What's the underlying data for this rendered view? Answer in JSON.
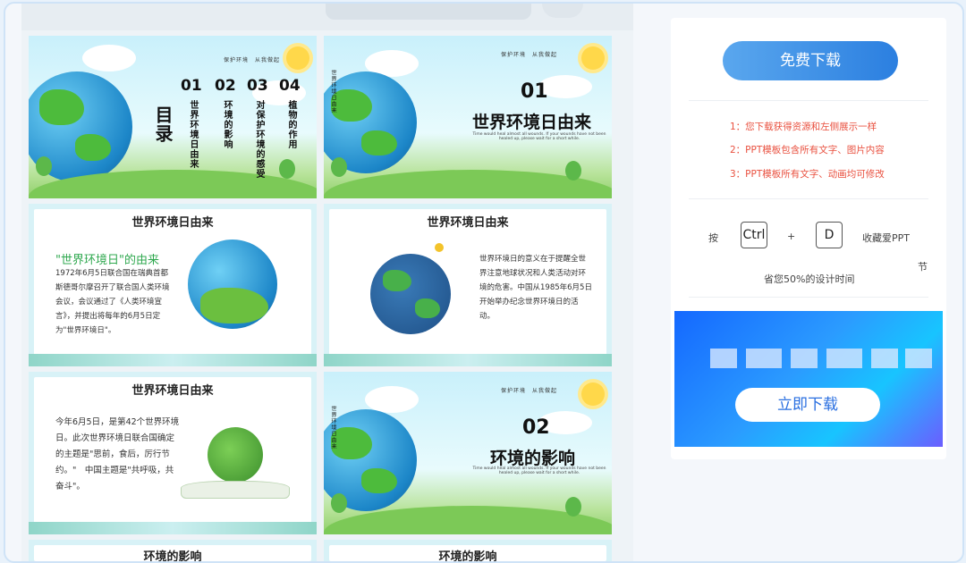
{
  "slides": {
    "toc": {
      "title": "目录",
      "tagline": "保护环境　从我做起",
      "items": [
        {
          "num": "01",
          "label": "世界环境日由来"
        },
        {
          "num": "02",
          "label": "环境的影响"
        },
        {
          "num": "03",
          "label": "对保护环境的感受"
        },
        {
          "num": "04",
          "label": "植物的作用"
        }
      ]
    },
    "section1": {
      "tagline": "保护环境　从我做起",
      "side_text": "世界环境日由来",
      "num": "01",
      "title": "世界环境日由来",
      "subtitle": "Time would heal almost all wounds. If your wounds have not been healed up, please wait for a short while."
    },
    "origin1": {
      "title": "世界环境日由来",
      "heading": "\"世界环境日\"的由来",
      "text": "1972年6月5日联合国在瑞典首都斯德哥尔摩召开了联合国人类环境会议，会议通过了《人类环境宣言》，并提出将每年的6月5日定为\"世界环境日\"。"
    },
    "origin2": {
      "title": "世界环境日由来",
      "text": "世界环境日的意义在于提醒全世界注意地球状况和人类活动对环境的危害。中国从1985年6月5日开始举办纪念世界环境日的活动。"
    },
    "origin3": {
      "title": "世界环境日由来",
      "text": "今年6月5日，是第42个世界环境日。此次世界环境日联合国确定的主题是\"思前，食后，厉行节约。\"　中国主题是\"共呼吸，共奋斗\"。"
    },
    "section2": {
      "tagline": "保护环境　从我做起",
      "side_text": "世界环境日由来",
      "num": "02",
      "title": "环境的影响",
      "subtitle": "Time would heal almost all wounds. If your wounds have not been healed up, please wait for a short while."
    },
    "bottom_left_title": "环境的影响",
    "bottom_right_title": "环境的影响"
  },
  "sidebar": {
    "free_download": "免费下载",
    "notes": [
      "1：您下载获得资源和左侧展示一样",
      "2：PPT模板包含所有文字、图片内容",
      "3：PPT模板所有文字、动画均可修改"
    ],
    "shortcut": {
      "press": "按",
      "key1": "Ctrl",
      "plus": "+",
      "key2": "D",
      "collect": "收藏爱PPT",
      "jie": "节",
      "save_time": "省您50%的设计时间"
    },
    "banner_button": "立即下载"
  },
  "colors": {
    "accent_blue": "#2b7fe0",
    "note_red": "#e9503f",
    "heading_green": "#2fa84f"
  }
}
